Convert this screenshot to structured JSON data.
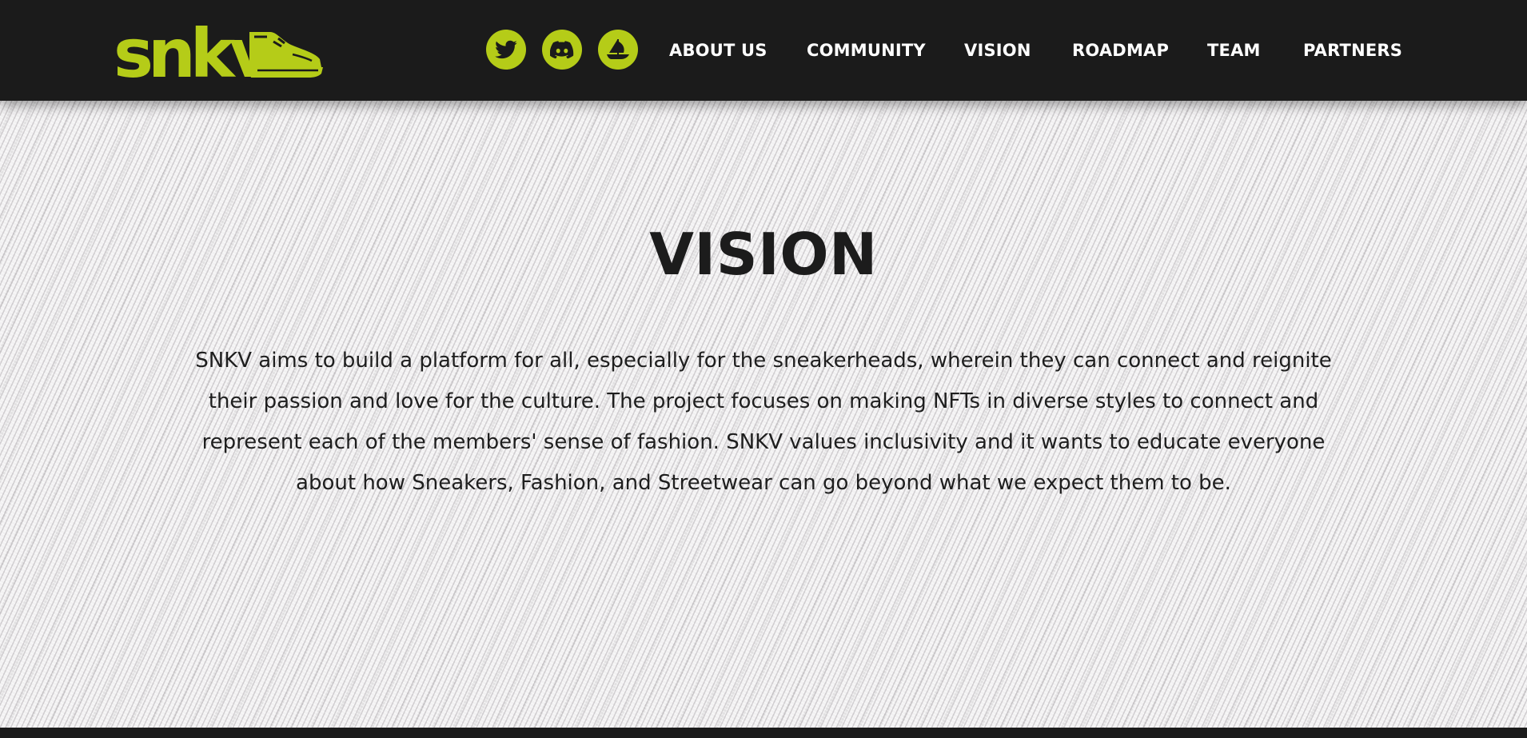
{
  "header": {
    "logo_text": "snkv",
    "social": [
      {
        "icon": "twitter-icon"
      },
      {
        "icon": "discord-icon"
      },
      {
        "icon": "opensea-icon"
      }
    ],
    "nav": [
      "ABOUT US",
      "COMMUNITY",
      "VISION",
      "ROADMAP",
      "TEAM",
      "PARTNERS"
    ]
  },
  "main": {
    "title": "VISION",
    "body": "SNKV aims to build a platform for all, especially for the sneakerheads, wherein they can connect and reignite their passion and love for the culture. The project focuses on making NFTs in diverse styles to connect and represent each of the members' sense of fashion. SNKV values inclusivity and it wants to educate everyone about how Sneakers, Fashion, and Streetwear can go beyond what we expect them to be."
  },
  "colors": {
    "accent": "#b5cc18",
    "header_bg": "#1b1b1b",
    "nav_text": "#ffffff",
    "title_text": "#1c1c1c",
    "page_bg": "#f2f1f2"
  }
}
